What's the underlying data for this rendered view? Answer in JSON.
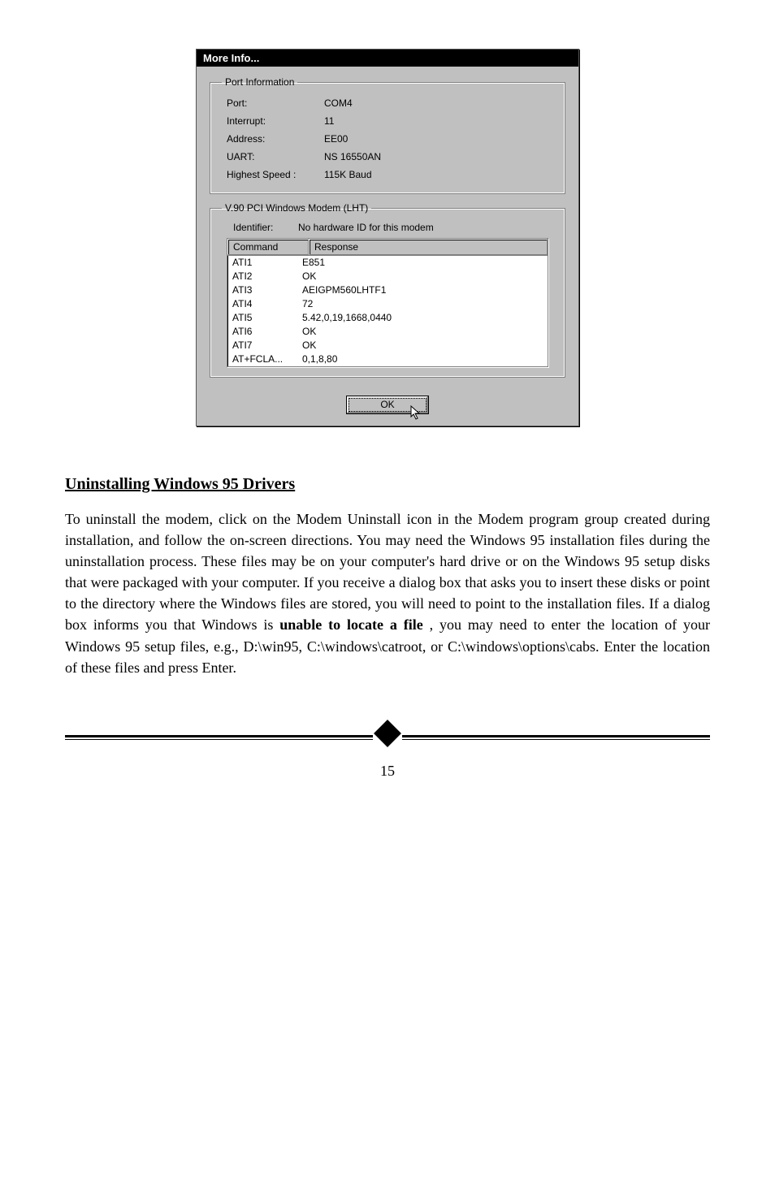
{
  "dialog": {
    "title": "More Info...",
    "port_info": {
      "legend": "Port Information",
      "rows": [
        {
          "label": "Port:",
          "value": "COM4"
        },
        {
          "label": "Interrupt:",
          "value": "11"
        },
        {
          "label": "Address:",
          "value": "EE00"
        },
        {
          "label": "UART:",
          "value": "NS 16550AN"
        },
        {
          "label": "Highest Speed :",
          "value": "115K Baud"
        }
      ]
    },
    "modem_group": {
      "legend": "V.90 PCI Windows Modem (LHT)",
      "identifier_label": "Identifier:",
      "identifier_value": "No hardware ID for this modem",
      "headers": {
        "command": "Command",
        "response": "Response"
      },
      "rows": [
        {
          "command": "ATI1",
          "response": "E851"
        },
        {
          "command": "ATI2",
          "response": "OK"
        },
        {
          "command": "ATI3",
          "response": "AEIGPM560LHTF1"
        },
        {
          "command": "ATI4",
          "response": "72"
        },
        {
          "command": "ATI5",
          "response": "5.42,0,19,1668,0440"
        },
        {
          "command": "ATI6",
          "response": "OK"
        },
        {
          "command": "ATI7",
          "response": "OK"
        },
        {
          "command": "AT+FCLA...",
          "response": "0,1,8,80"
        }
      ]
    },
    "ok_label": "OK"
  },
  "section": {
    "heading": "Uninstalling Windows 95 Drivers",
    "p1_pre": "To uninstall the modem, click on the Modem Uninstall icon in the Modem program group created during installation, and follow the on-screen directions. You may need the Windows 95 installation files during the uninstallation process. These files may be on your computer's hard drive or on the Windows 95 setup disks that were packaged with your computer. If you receive a dialog box that asks you to insert these disks or point to the directory where the Windows files are stored, you will need to point to the installation files. If a dialog box informs you that Windows is ",
    "p1_bold": "unable to locate a file",
    "p1_post": ", you may need to enter the location of your Windows 95 setup files, e.g., D:\\win95, C:\\windows\\catroot, or C:\\windows\\options\\cabs. Enter the location of these files and press Enter."
  },
  "page_number": "15"
}
